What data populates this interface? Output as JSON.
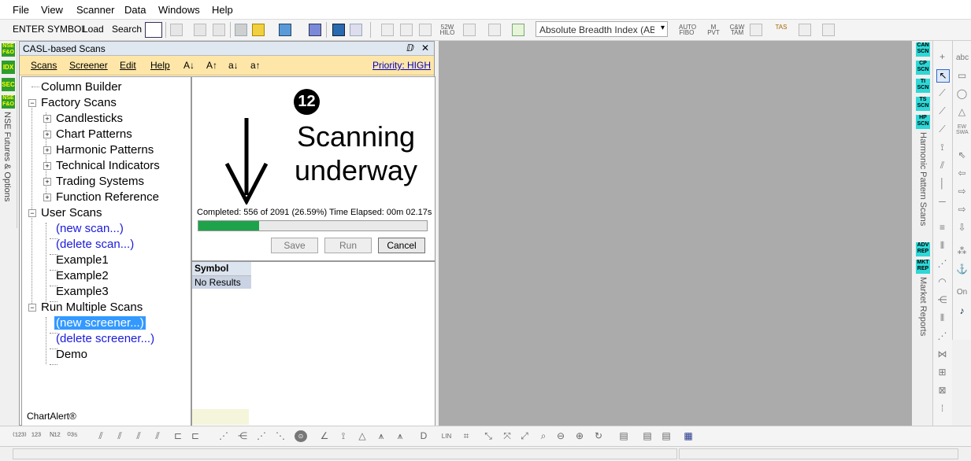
{
  "menubar": {
    "items": [
      "File",
      "View",
      "Scanner",
      "Data",
      "Windows",
      "Help"
    ]
  },
  "toolbar": {
    "enter_symbol": "ENTER SYMBOL",
    "load": "Load",
    "search": "Search",
    "indicator_select": "Absolute Breadth Index (ABI",
    "mini_labels": [
      "52W HILO",
      "AUTO FIBO",
      "M PVT",
      "C&W TAM",
      "TAS"
    ]
  },
  "left_strip": {
    "buttons": [
      "NSE F&O",
      "IDX",
      "SEC",
      "NSE F&O"
    ],
    "vertical_label": "NSE Futures & Options"
  },
  "panel": {
    "title": "CASL-based Scans",
    "pin": "ⅅ",
    "close": "✕",
    "menu": [
      "Scans",
      "Screener",
      "Edit",
      "Help"
    ],
    "sort_buttons": [
      "A↓",
      "A↑",
      "a↓",
      "a↑"
    ],
    "priority": "Priority: HIGH",
    "footer": "ChartAlert®"
  },
  "tree": {
    "column_builder": "Column Builder",
    "factory_scans": "Factory Scans",
    "factory_children": [
      "Candlesticks",
      "Chart Patterns",
      "Harmonic Patterns",
      "Technical Indicators",
      "Trading Systems",
      "Function Reference"
    ],
    "user_scans": "User Scans",
    "user_children": [
      "(new scan...)",
      "(delete scan...)",
      "Example1",
      "Example2",
      "Example3"
    ],
    "run_multiple": "Run Multiple Scans",
    "run_children": [
      "(new screener...)",
      "(delete screener...)",
      "Demo"
    ]
  },
  "progress": {
    "step_number": "12",
    "annotation": "Scanning underway",
    "status": "Completed: 556 of 2091 (26.59%) Time Elapsed: 00m 02.17s",
    "fraction": 0.2659,
    "save": "Save",
    "run": "Run",
    "cancel": "Cancel"
  },
  "results": {
    "header": "Symbol",
    "empty": "No Results"
  },
  "right_bar": {
    "buttons": [
      "CAN SCN",
      "CP SCN",
      "TI SCN",
      "TS SCN",
      "HP SCN"
    ],
    "label1": "Harmonic Pattern Scans",
    "buttons2": [
      "ADV REP",
      "MKT REP"
    ],
    "label2": "Market Reports"
  },
  "tools": {
    "abc": "abc",
    "fib": "EW SWA",
    "on": "On",
    "lin": "LIN"
  },
  "colors": {
    "progress_fill": "#1ea34a",
    "workspace": "#ababab",
    "panel_menu": "#fde6a8",
    "selection": "#3399ff"
  }
}
